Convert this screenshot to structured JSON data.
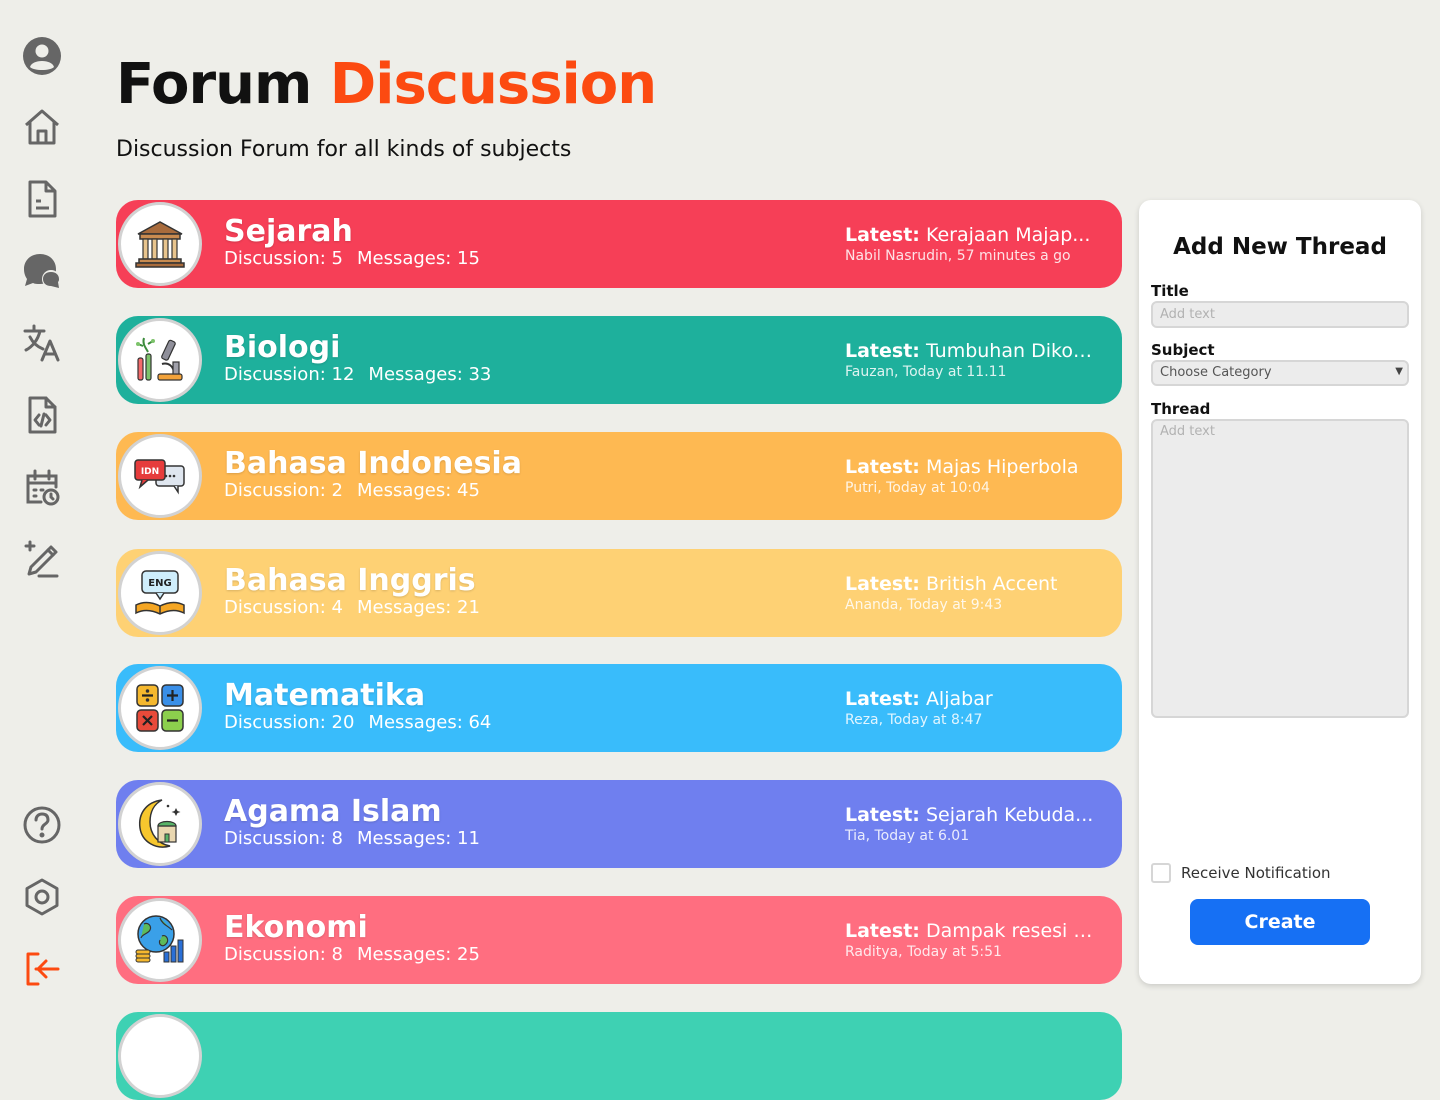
{
  "header": {
    "title_part1": "Forum ",
    "title_part2": "Discussion",
    "subtitle": "Discussion Forum for all kinds of subjects"
  },
  "sidebar": {
    "icons": [
      "user-icon",
      "home-icon",
      "document-icon",
      "chat-icon",
      "translate-icon",
      "code-file-icon",
      "calendar-clock-icon",
      "edit-pen-icon",
      "help-icon",
      "settings-icon",
      "logout-icon"
    ]
  },
  "forums": [
    {
      "name": "Sejarah",
      "discussion": "Discussion: 5",
      "messages": "Messages: 15",
      "latest_label": "Latest:",
      "latest_title": "Kerajaan Majap...",
      "latest_meta": "Nabil Nasrudin, 57 minutes a go",
      "color": "#f63f57",
      "icon": "museum-icon"
    },
    {
      "name": "Biologi",
      "discussion": "Discussion: 12",
      "messages": "Messages: 33",
      "latest_label": "Latest:",
      "latest_title": "Tumbuhan Dikoti...",
      "latest_meta": "Fauzan, Today at 11.11",
      "color": "#1eb09c",
      "icon": "microscope-plant-icon"
    },
    {
      "name": "Bahasa Indonesia",
      "discussion": "Discussion: 2",
      "messages": "Messages: 45",
      "latest_label": "Latest:",
      "latest_title": "Majas Hiperbola",
      "latest_meta": "Putri, Today at 10:04",
      "color": "#feb952",
      "icon": "idn-chat-icon",
      "icon_text": "IDN"
    },
    {
      "name": "Bahasa Inggris",
      "discussion": "Discussion: 4",
      "messages": "Messages: 21",
      "latest_label": "Latest:",
      "latest_title": "British Accent",
      "latest_meta": "Ananda, Today at 9:43",
      "color": "#fed174",
      "icon": "eng-book-icon",
      "icon_text": "ENG"
    },
    {
      "name": "Matematika",
      "discussion": "Discussion: 20",
      "messages": "Messages: 64",
      "latest_label": "Latest:",
      "latest_title": "Aljabar",
      "latest_meta": "Reza, Today at 8:47",
      "color": "#39bcfb",
      "icon": "calculator-symbols-icon"
    },
    {
      "name": "Agama Islam",
      "discussion": "Discussion: 8",
      "messages": "Messages: 11",
      "latest_label": "Latest:",
      "latest_title": "Sejarah Kebuda...",
      "latest_meta": "Tia, Today at 6.01",
      "color": "#6f7fef",
      "icon": "mosque-moon-icon"
    },
    {
      "name": "Ekonomi",
      "discussion": "Discussion: 8",
      "messages": "Messages: 25",
      "latest_label": "Latest:",
      "latest_title": "Dampak resesi g...",
      "latest_meta": "Raditya, Today at 5:51",
      "color": "#ff6e80",
      "icon": "globe-chart-icon"
    },
    {
      "color": "#3ed1b3"
    }
  ],
  "new_thread": {
    "heading": "Add New Thread",
    "title_label": "Title",
    "title_placeholder": "Add text",
    "subject_label": "Subject",
    "subject_value": "Choose Category",
    "thread_label": "Thread",
    "thread_placeholder": "Add text",
    "notification_label": "Receive Notification",
    "create_label": "Create"
  },
  "colors": {
    "accent": "#fc4a11",
    "primary_button": "#1670f4",
    "background": "#eeeee9"
  }
}
